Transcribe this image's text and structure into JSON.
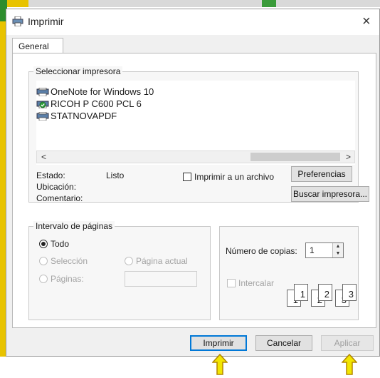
{
  "window": {
    "title": "Imprimir",
    "close_glyph": "×"
  },
  "tabs": [
    {
      "label": "General"
    }
  ],
  "printer_group": {
    "label": "Seleccionar impresora",
    "printers": [
      {
        "name": "OneNote for Windows 10",
        "icon": "printer-icon"
      },
      {
        "name": "RICOH P C600 PCL 6",
        "icon": "printer-default-icon"
      },
      {
        "name": "STATNOVAPDF",
        "icon": "printer-icon"
      }
    ],
    "scroll_left": "<",
    "scroll_right": ">",
    "status_label": "Estado:",
    "status_value": "Listo",
    "location_label": "Ubicación:",
    "comment_label": "Comentario:",
    "print_to_file_label": "Imprimir a un archivo",
    "preferences_button": "Preferencias",
    "find_printer_button": "Buscar impresora..."
  },
  "page_range": {
    "label": "Intervalo de páginas",
    "all_label": "Todo",
    "selection_label": "Selección",
    "current_page_label": "Página actual",
    "pages_label": "Páginas:"
  },
  "copies": {
    "label": "Número de copias:",
    "value": "1",
    "collate_label": "Intercalar",
    "collate_pages": [
      "1",
      "1",
      "2",
      "2",
      "3",
      "3"
    ]
  },
  "footer": {
    "print_button": "Imprimir",
    "cancel_button": "Cancelar",
    "apply_button": "Aplicar"
  },
  "colors": {
    "accent": "#0078d7",
    "annotation_arrow": "#f2e600",
    "annotation_arrow_outline": "#b38600"
  }
}
